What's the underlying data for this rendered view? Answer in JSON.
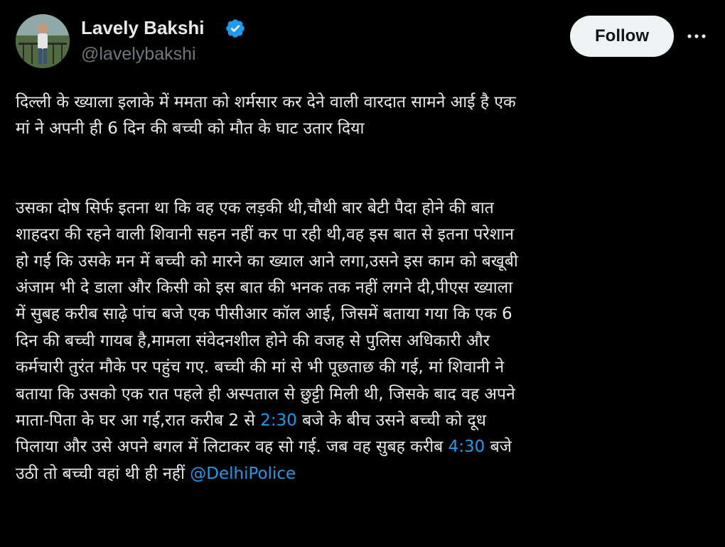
{
  "header": {
    "display_name": "Lavely Bakshi",
    "handle": "@lavelybakshi",
    "verified_icon": "verified-badge-icon",
    "follow_label": "Follow",
    "more_icon": "more-options-icon",
    "avatar": "profile-photo"
  },
  "tweet": {
    "para1": {
      "line1": "दिल्ली के ख्याला इलाके में ममता को शर्मसार कर देने वाली वारदात सामने आई है एक",
      "line2": "मां ने अपनी ही 6 दिन की बच्ची को मौत के घाट उतार दिया"
    },
    "para2": {
      "line1": "उसका दोष सिर्फ इतना था कि वह एक लड़की थी,चौथी बार बेटी पैदा होने की बात",
      "line2": "शाहदरा की रहने वाली शिवानी सहन नहीं कर पा रही थी,वह इस बात से इतना परेशान",
      "line3": "हो गई कि उसके मन में बच्ची को मारने का ख्याल आने लगा,उसने इस काम को बखूबी",
      "line4": "अंजाम भी दे डाला और किसी को इस बात की भनक तक नहीं लगने दी,पीएस ख्याला",
      "line5": "में सुबह करीब साढ़े पांच बजे एक पीसीआर कॉल आई, जिसमें बताया गया कि एक 6",
      "line6": "दिन की बच्ची गायब है,मामला संवेदनशील होने की वजह से पुलिस अधिकारी और",
      "line7": "कर्मचारी तुरंत मौके पर पहुंच गए. बच्ची की मां से भी पूछताछ की गई, मां शिवानी ने",
      "line8": "बताया कि  उसको एक रात पहले ही अस्पताल से छुट्टी मिली थी, जिसके बाद वह अपने",
      "line9_pre": "माता-पिता के घर आ गई,रात करीब 2 से ",
      "line9_link": "2:30",
      "line9_post": " बजे के बीच उसने बच्ची को दूध",
      "line10_pre": "पिलाया और उसे अपने बगल में लिटाकर वह सो गई. जब वह सुबह करीब ",
      "line10_link": "4:30",
      "line10_post": " बजे",
      "line11_pre": "उठी तो बच्ची वहां थी ही नहीं ",
      "line11_mention": "@DelhiPolice"
    }
  },
  "colors": {
    "background": "#000000",
    "text": "#e7e9ea",
    "secondary_text": "#71767b",
    "link": "#1d9bf0",
    "verified": "#1d9bf0",
    "follow_bg": "#eff3f4"
  }
}
